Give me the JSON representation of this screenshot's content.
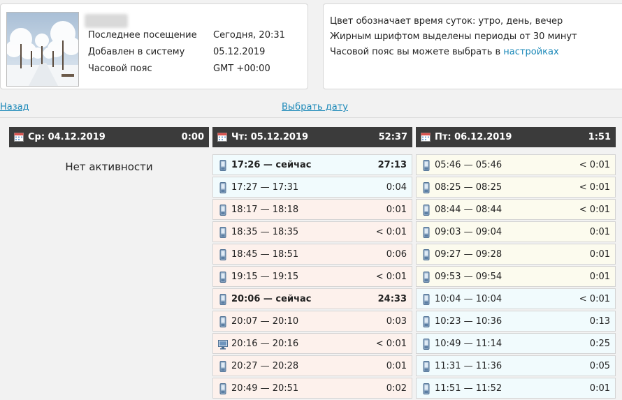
{
  "profile": {
    "username": "",
    "rows": [
      {
        "label": "Последнее посещение",
        "value": "Сегодня, 20:31"
      },
      {
        "label": "Добавлен в систему",
        "value": "05.12.2019"
      },
      {
        "label": "Часовой пояс",
        "value": "GMT +00:00"
      }
    ]
  },
  "legend": {
    "line1": "Цвет обозначает время суток: утро, день, вечер",
    "line2": "Жирным шрифтом выделены периоды от 30 минут",
    "line3_prefix": "Часовой пояс вы можете выбрать в ",
    "line3_link": "настройках"
  },
  "nav": {
    "back": "Назад",
    "choose_date": "Выбрать дату"
  },
  "days": [
    {
      "title": "Ср: 04.12.2019",
      "total": "0:00",
      "empty_text": "Нет активности",
      "entries": []
    },
    {
      "title": "Чт: 05.12.2019",
      "total": "52:37",
      "entries": [
        {
          "range": "17:26 — сейчас",
          "dur": "27:13",
          "tod": "day",
          "bold": true,
          "device": "phone"
        },
        {
          "range": "17:27 — 17:31",
          "dur": "0:04",
          "tod": "day",
          "bold": false,
          "device": "phone"
        },
        {
          "range": "18:17 — 18:18",
          "dur": "0:01",
          "tod": "evening",
          "bold": false,
          "device": "phone"
        },
        {
          "range": "18:35 — 18:35",
          "dur": "< 0:01",
          "tod": "evening",
          "bold": false,
          "device": "phone"
        },
        {
          "range": "18:45 — 18:51",
          "dur": "0:06",
          "tod": "evening",
          "bold": false,
          "device": "phone"
        },
        {
          "range": "19:15 — 19:15",
          "dur": "< 0:01",
          "tod": "evening",
          "bold": false,
          "device": "phone"
        },
        {
          "range": "20:06 — сейчас",
          "dur": "24:33",
          "tod": "evening",
          "bold": true,
          "device": "phone"
        },
        {
          "range": "20:07 — 20:10",
          "dur": "0:03",
          "tod": "evening",
          "bold": false,
          "device": "phone"
        },
        {
          "range": "20:16 — 20:16",
          "dur": "< 0:01",
          "tod": "evening",
          "bold": false,
          "device": "desktop"
        },
        {
          "range": "20:27 — 20:28",
          "dur": "0:01",
          "tod": "evening",
          "bold": false,
          "device": "phone"
        },
        {
          "range": "20:49 — 20:51",
          "dur": "0:02",
          "tod": "evening",
          "bold": false,
          "device": "phone"
        }
      ]
    },
    {
      "title": "Пт: 06.12.2019",
      "total": "1:51",
      "entries": [
        {
          "range": "05:46 — 05:46",
          "dur": "< 0:01",
          "tod": "morning",
          "bold": false,
          "device": "phone"
        },
        {
          "range": "08:25 — 08:25",
          "dur": "< 0:01",
          "tod": "morning",
          "bold": false,
          "device": "phone"
        },
        {
          "range": "08:44 — 08:44",
          "dur": "< 0:01",
          "tod": "morning",
          "bold": false,
          "device": "phone"
        },
        {
          "range": "09:03 — 09:04",
          "dur": "0:01",
          "tod": "morning",
          "bold": false,
          "device": "phone"
        },
        {
          "range": "09:27 — 09:28",
          "dur": "0:01",
          "tod": "morning",
          "bold": false,
          "device": "phone"
        },
        {
          "range": "09:53 — 09:54",
          "dur": "0:01",
          "tod": "morning",
          "bold": false,
          "device": "phone"
        },
        {
          "range": "10:04 — 10:04",
          "dur": "< 0:01",
          "tod": "day",
          "bold": false,
          "device": "phone"
        },
        {
          "range": "10:23 — 10:36",
          "dur": "0:13",
          "tod": "day",
          "bold": false,
          "device": "phone"
        },
        {
          "range": "10:49 — 11:14",
          "dur": "0:25",
          "tod": "day",
          "bold": false,
          "device": "phone"
        },
        {
          "range": "11:31 — 11:36",
          "dur": "0:05",
          "tod": "day",
          "bold": false,
          "device": "phone"
        },
        {
          "range": "11:51 — 11:52",
          "dur": "0:01",
          "tod": "day",
          "bold": false,
          "device": "phone"
        }
      ]
    }
  ],
  "colors": {
    "morning": "#fcfbee",
    "day": "#f1fbfd",
    "evening": "#fdf1ec",
    "header": "#3b3b3b",
    "link": "#1a88b8"
  }
}
